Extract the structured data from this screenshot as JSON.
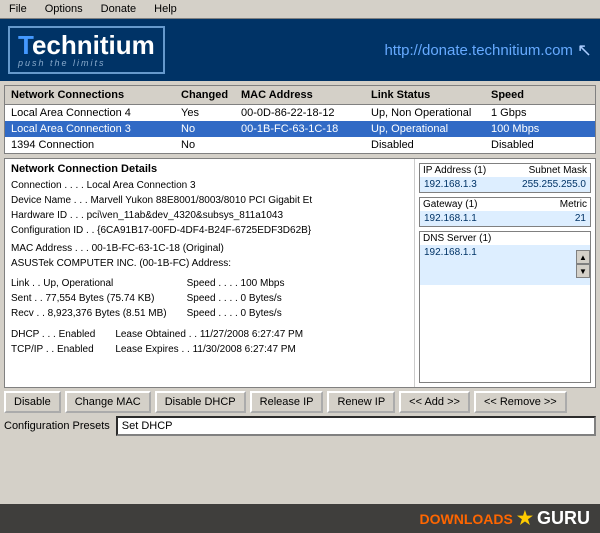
{
  "menu": {
    "items": [
      "File",
      "Options",
      "Donate",
      "Help"
    ]
  },
  "header": {
    "logo_t": "T",
    "logo_rest": "echnitium",
    "tagline": "push the limits",
    "donate_url": "http://donate.technitium.com"
  },
  "connections_table": {
    "columns": [
      "Network Connections",
      "Changed",
      "MAC Address",
      "Link Status",
      "Speed"
    ],
    "rows": [
      {
        "name": "Local Area Connection 4",
        "changed": "Yes",
        "mac": "00-0D-86-22-18-12",
        "link_status": "Up, Non Operational",
        "speed": "1 Gbps",
        "selected": false
      },
      {
        "name": "Local Area Connection 3",
        "changed": "No",
        "mac": "00-1B-FC-63-1C-18",
        "link_status": "Up, Operational",
        "speed": "100 Mbps",
        "selected": true
      },
      {
        "name": "1394 Connection",
        "changed": "No",
        "mac": "",
        "link_status": "Disabled",
        "speed": "Disabled",
        "selected": false
      }
    ]
  },
  "details": {
    "title": "Network Connection Details",
    "connection": "Connection . . . . Local Area Connection 3",
    "device_name": "Device Name . . . Marvell Yukon 88E8001/8003/8010 PCI Gigabit Et",
    "hardware_id": "Hardware ID . . . pci\\ven_11ab&dev_4320&subsys_811a1043",
    "config_id": "Configuration ID . . {6CA91B17-00FD-4DF4-B24F-6725EDF3D62B}",
    "mac_address": "MAC Address . . . 00-1B-FC-63-1C-18 (Original)",
    "mac_vendor": "ASUSTek COMPUTER INC. (00-1B-FC)  Address:",
    "link": "Link . . Up, Operational",
    "speed": "Speed . . . . 100 Mbps",
    "sent": "Sent . . 77,554 Bytes (75.74 KB)",
    "sent_speed": "Speed . . . . 0 Bytes/s",
    "recv": "Recv . . 8,923,376 Bytes (8.51 MB)",
    "recv_speed": "Speed . . . . 0 Bytes/s",
    "dhcp": "DHCP . . . Enabled",
    "lease_obtained": "Lease Obtained . . 11/27/2008 6:27:47 PM",
    "tcpip": "TCP/IP . . Enabled",
    "lease_expires": "Lease Expires . . 11/30/2008 6:27:47 PM"
  },
  "ip_info": {
    "ip_label": "IP Address (1)",
    "subnet_label": "Subnet Mask",
    "ip_value": "192.168.1.3",
    "subnet_value": "255.255.255.0",
    "gateway_label": "Gateway (1)",
    "metric_label": "Metric",
    "gateway_value": "192.168.1.1",
    "metric_value": "21",
    "dns_label": "DNS Server (1)",
    "dns_value": "192.168.1.1"
  },
  "buttons": {
    "disable": "Disable",
    "change_mac": "Change MAC",
    "disable_dhcp": "Disable DHCP",
    "release_ip": "Release IP",
    "renew_ip": "Renew IP",
    "add": "<< Add >>",
    "remove": "<< Remove >>"
  },
  "presets": {
    "label": "Configuration Presets",
    "value": "Set DHCP"
  },
  "watermark": {
    "text": "DOWNLOADS",
    "separator": "★",
    "guru": "GURU"
  }
}
